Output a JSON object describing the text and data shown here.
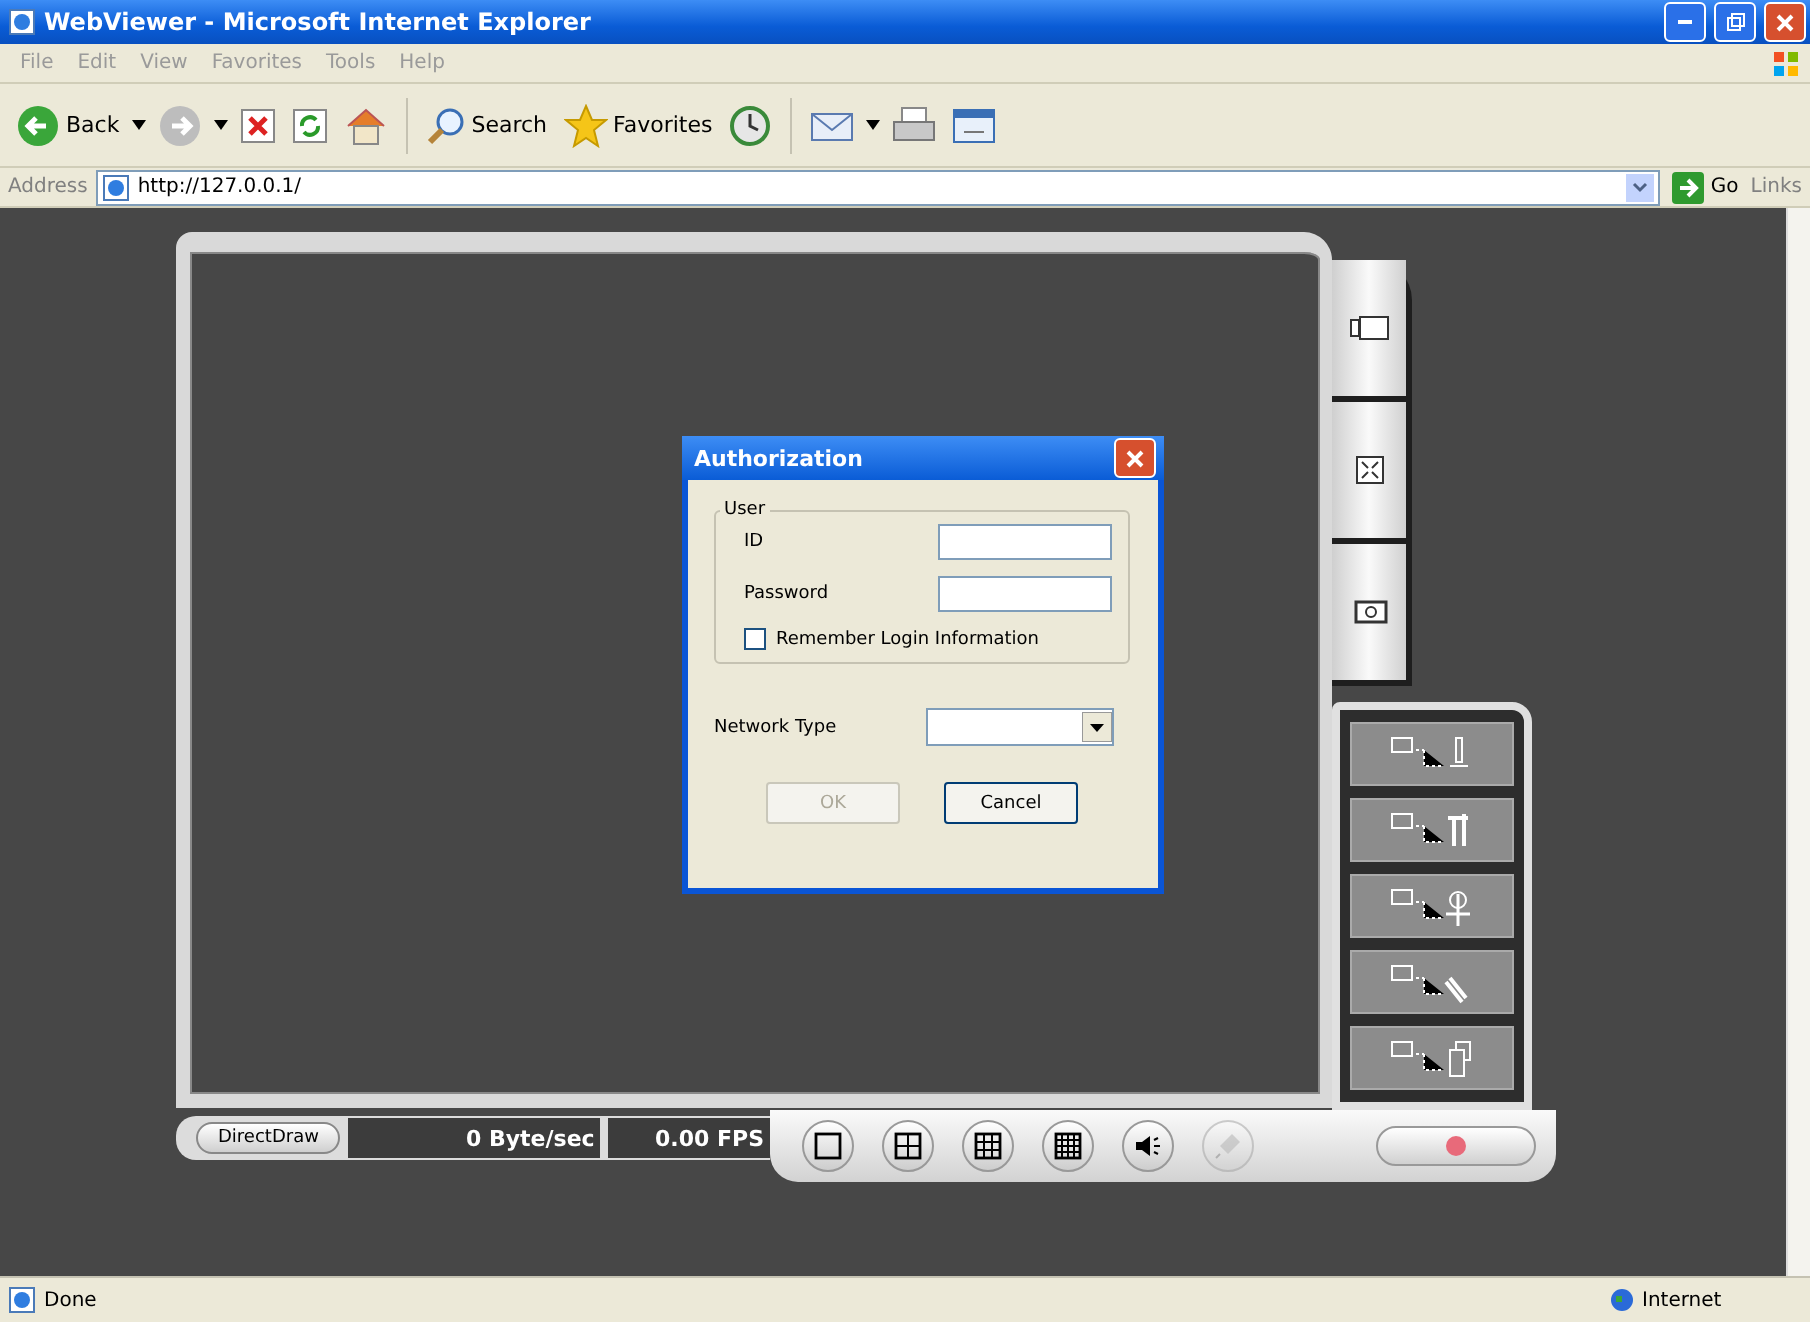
{
  "window": {
    "title": "WebViewer - Microsoft Internet Explorer"
  },
  "menu": [
    "File",
    "Edit",
    "View",
    "Favorites",
    "Tools",
    "Help"
  ],
  "toolbar": {
    "back": "Back",
    "search": "Search",
    "favorites": "Favorites"
  },
  "address_bar": {
    "label": "Address",
    "url": "http://127.0.0.1/",
    "go": "Go",
    "links": "Links"
  },
  "viewer": {
    "render_mode": "DirectDraw",
    "bitrate": "0 Byte/sec",
    "fps": "0.00 FPS",
    "side_tabs": [
      {
        "kind": "camera"
      },
      {
        "kind": "fullscreen"
      },
      {
        "kind": "snapshot"
      }
    ],
    "tools": [
      {
        "kind": "ptz"
      },
      {
        "kind": "setup"
      },
      {
        "kind": "search"
      },
      {
        "kind": "remote"
      },
      {
        "kind": "copy"
      }
    ],
    "layouts": [
      {
        "kind": "single"
      },
      {
        "kind": "quad"
      },
      {
        "kind": "nine"
      },
      {
        "kind": "sixteen"
      }
    ],
    "audio": [
      {
        "kind": "speaker",
        "disabled": false
      },
      {
        "kind": "microphone",
        "disabled": true
      }
    ],
    "record": {
      "on": false
    }
  },
  "dialog": {
    "title": "Authorization",
    "group": "User",
    "fields": [
      {
        "label": "ID"
      },
      {
        "label": "Password"
      }
    ],
    "remember": {
      "label": "Remember Login Information",
      "checked": false
    },
    "network": {
      "label": "Network Type"
    },
    "buttons": [
      {
        "label": "OK",
        "disabled": true
      },
      {
        "label": "Cancel",
        "disabled": false
      }
    ]
  },
  "status_bar": {
    "text": "Done",
    "zone": "Internet"
  }
}
